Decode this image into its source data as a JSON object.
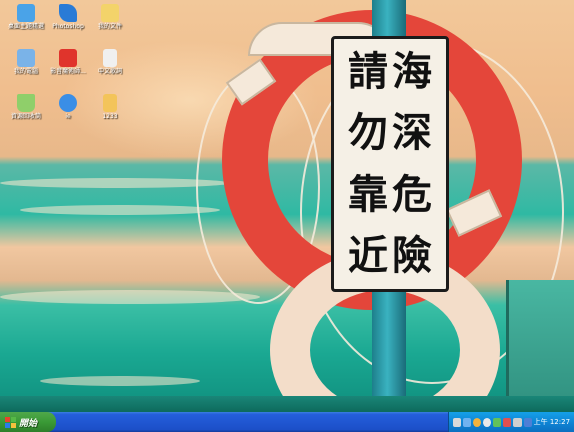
{
  "desktop": {
    "icons": [
      {
        "label": "桌面主題精選",
        "icon": "theme-icon",
        "color": "#4aa3e8"
      },
      {
        "label": "Photoshop",
        "icon": "photoshop-feather-icon",
        "color": "#2a7bd6"
      },
      {
        "label": "我的文件",
        "icon": "my-documents-folder-icon",
        "color": "#f3d36a"
      },
      {
        "label": "我的電腦",
        "icon": "my-computer-icon",
        "color": "#7ab3e8"
      },
      {
        "label": "影音魔術師...",
        "icon": "media-app-icon",
        "color": "#e0342c"
      },
      {
        "label": "中文歌詞",
        "icon": "text-file-icon",
        "color": "#f0f0f0"
      },
      {
        "label": "資源回收筒",
        "icon": "recycle-bin-icon",
        "color": "#8fcf6a"
      },
      {
        "label": "ie",
        "icon": "internet-explorer-icon",
        "color": "#3a8ee6"
      },
      {
        "label": "1233",
        "icon": "image-file-icon",
        "color": "#f3c45a"
      }
    ]
  },
  "sign": {
    "right_column": [
      "海",
      "深",
      "危",
      "險"
    ],
    "left_column": [
      "請",
      "勿",
      "靠",
      "近"
    ]
  },
  "taskbar": {
    "start_label": "開始",
    "clock": "上午 12:27",
    "start_color": "#3a9a36",
    "bar_color": "#245edb"
  }
}
